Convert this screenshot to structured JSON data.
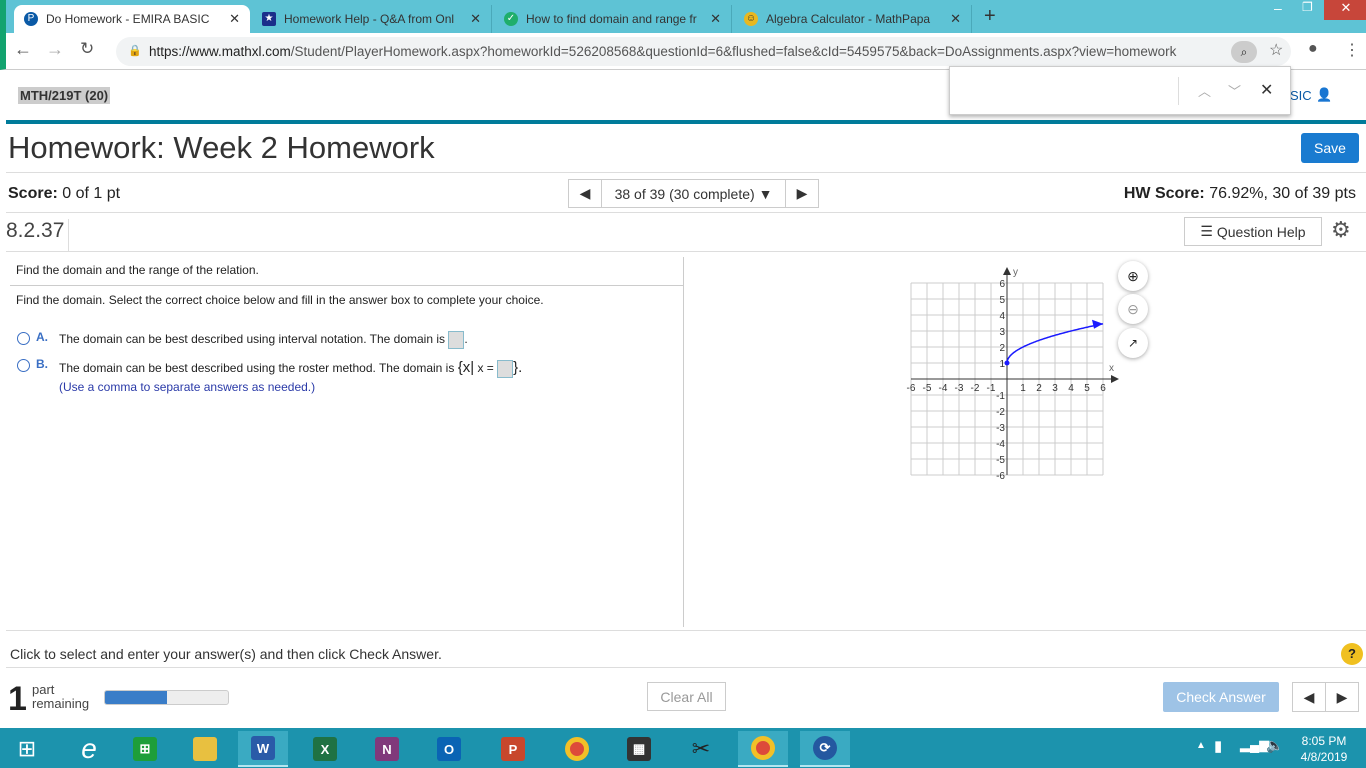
{
  "browser": {
    "tabs": [
      {
        "title": "Do Homework - EMIRA BASIC",
        "icon": "pearson-icon",
        "active": true
      },
      {
        "title": "Homework Help - Q&A from Onl",
        "icon": "star-icon"
      },
      {
        "title": "How to find domain and range fr",
        "icon": "check-shield-icon"
      },
      {
        "title": "Algebra Calculator - MathPapa",
        "icon": "mathpapa-icon"
      }
    ],
    "url_host": "https://www.mathxl.com",
    "url_path": "/Student/PlayerHomework.aspx?homeworkId=526208568&questionId=6&flushed=false&cId=5459575&back=DoAssignments.aspx?view=homework",
    "find_value": ""
  },
  "header": {
    "course": "MTH/219T (20)",
    "user_partial": "SIC"
  },
  "title": "Homework: Week 2 Homework",
  "save_label": "Save",
  "score": {
    "label": "Score:",
    "value": "0 of 1 pt",
    "hw_label": "HW Score:",
    "hw_value": "76.92%, 30 of 39 pts"
  },
  "nav": {
    "position": "38 of 39 (30 complete)"
  },
  "question": {
    "number": "8.2.37",
    "help_label": "Question Help",
    "prompt": "Find the domain and the range of the relation.",
    "instruction": "Find the domain. Select the correct choice below and fill in the answer box to complete your choice.",
    "choices": [
      {
        "letter": "A.",
        "text": "The domain can be best described using interval notation. The domain is",
        "suffix": "."
      },
      {
        "letter": "B.",
        "text": "The domain can be best described using the roster method. The domain is",
        "set_open": "{x|",
        "set_eq": "x =",
        "set_close": "}.",
        "note": "(Use a comma to separate answers as needed.)"
      }
    ]
  },
  "graph": {
    "xlabel": "x",
    "ylabel": "y",
    "xlim": [
      -6,
      6
    ],
    "ylim": [
      -6,
      6
    ],
    "grid": true,
    "curve": {
      "function": "y = sqrt(x) + 1",
      "start": [
        0,
        1
      ],
      "end_x": 6,
      "closed_start_point": true,
      "arrow_end": true,
      "color": "#1a1aff"
    }
  },
  "footer": {
    "hint": "Click to select and enter your answer(s) and then click Check Answer.",
    "parts_count": "1",
    "parts_label1": "part",
    "parts_label2": "remaining",
    "progress": 0.5,
    "clear_label": "Clear All",
    "check_label": "Check Answer"
  },
  "taskbar": {
    "time": "8:05 PM",
    "date": "4/8/2019"
  }
}
